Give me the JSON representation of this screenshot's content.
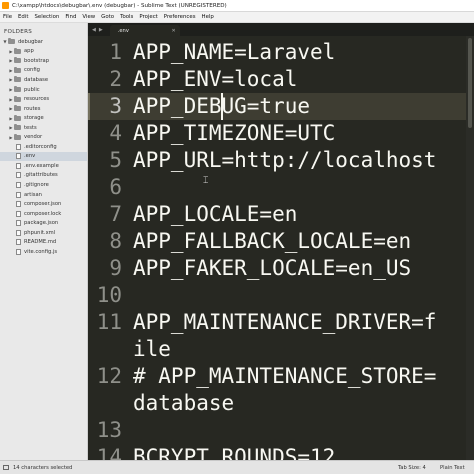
{
  "window": {
    "title": "C:\\xampp\\htdocs\\debugbar\\.env (debugbar) - Sublime Text (UNREGISTERED)"
  },
  "menu": [
    "File",
    "Edit",
    "Selection",
    "Find",
    "View",
    "Goto",
    "Tools",
    "Project",
    "Preferences",
    "Help"
  ],
  "sidebar": {
    "header": "FOLDERS",
    "root": "debugbar",
    "folders": [
      "app",
      "bootstrap",
      "config",
      "database",
      "public",
      "resources",
      "routes",
      "storage",
      "tests",
      "vendor"
    ],
    "files": [
      ".editorconfig",
      ".env",
      ".env.example",
      ".gitattributes",
      ".gitignore",
      "artisan",
      "composer.json",
      "composer.lock",
      "package.json",
      "phpunit.xml",
      "README.md",
      "vite.config.js"
    ],
    "selected_file": ".env"
  },
  "tabs": [
    {
      "label": ".env",
      "active": true
    }
  ],
  "editor": {
    "current_line": 3,
    "lines": [
      {
        "n": "1",
        "text": "APP_NAME=Laravel"
      },
      {
        "n": "2",
        "text": "APP_ENV=local"
      },
      {
        "n": "3",
        "text": "APP_DEBUG=true"
      },
      {
        "n": "4",
        "text": "APP_TIMEZONE=UTC"
      },
      {
        "n": "5",
        "text": "APP_URL=http://localhost"
      },
      {
        "n": "6",
        "text": ""
      },
      {
        "n": "7",
        "text": "APP_LOCALE=en"
      },
      {
        "n": "8",
        "text": "APP_FALLBACK_LOCALE=en"
      },
      {
        "n": "9",
        "text": "APP_FAKER_LOCALE=en_US"
      },
      {
        "n": "10",
        "text": ""
      },
      {
        "n": "11",
        "text": "APP_MAINTENANCE_DRIVER=f"
      },
      {
        "n": "",
        "text": "ile"
      },
      {
        "n": "12",
        "text": "# APP_MAINTENANCE_STORE="
      },
      {
        "n": "",
        "text": "database"
      },
      {
        "n": "13",
        "text": ""
      },
      {
        "n": "14",
        "text": "BCRYPT_ROUNDS=12"
      }
    ]
  },
  "statusbar": {
    "left": "14 characters selected",
    "tab_size": "Tab Size: 4",
    "syntax": "Plain Text"
  },
  "colors": {
    "editor_bg": "#272822",
    "text": "#f8f8f2",
    "gutter": "#8f908a",
    "current_line": "#3e3d32",
    "sidebar_bg": "#e9e9e9"
  }
}
